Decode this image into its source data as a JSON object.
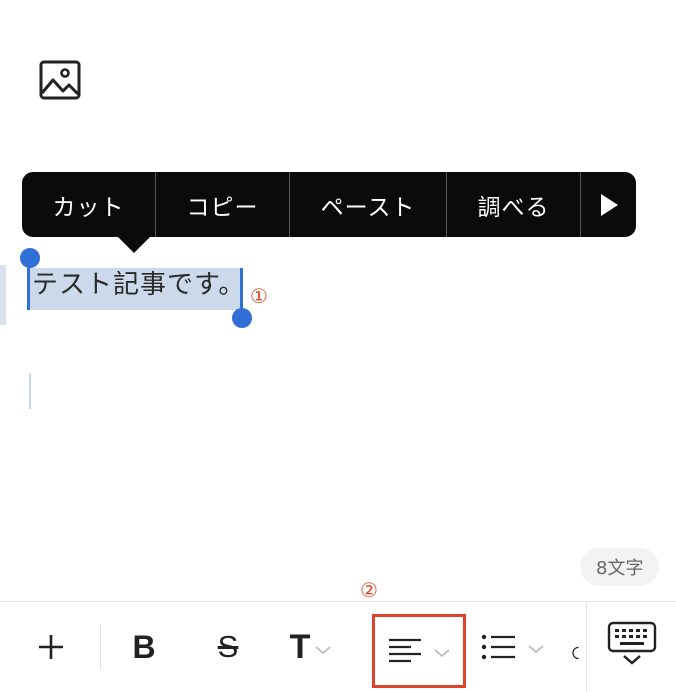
{
  "context_menu": {
    "items": [
      "カット",
      "コピー",
      "ペースト",
      "調べる"
    ],
    "more_icon": "triangle-right-icon"
  },
  "editor": {
    "image_block_icon": "image-icon",
    "selected_text": "テスト記事です。",
    "annotation_1": "①",
    "annotation_2": "②",
    "char_count": "8文字"
  },
  "toolbar": {
    "plus_icon": "plus-icon",
    "bold_label": "B",
    "strike_label": "S",
    "text_size_label": "T",
    "align_icon": "align-left-icon",
    "list_icon": "bullet-list-icon",
    "keyboard_icon": "keyboard-hide-icon",
    "highlight_color": "#e0432c",
    "selection_color": "#2f6fd6"
  }
}
